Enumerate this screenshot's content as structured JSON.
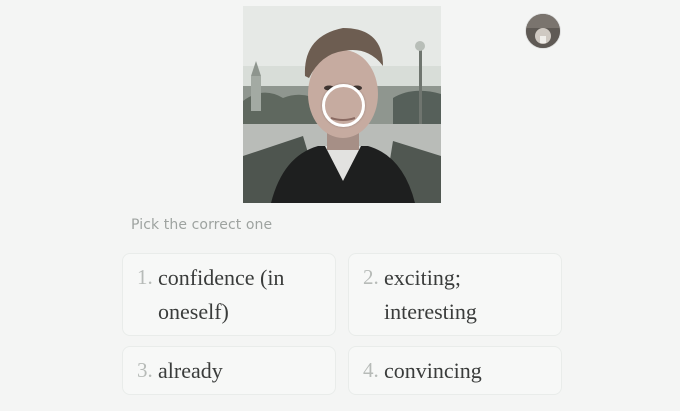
{
  "avatar": {
    "icon": "user-avatar"
  },
  "photo": {
    "subject": "portrait-photo"
  },
  "prompt": "Pick the correct one",
  "options": [
    {
      "number": "1.",
      "text": "confidence (in oneself)"
    },
    {
      "number": "2.",
      "text": "exciting; interesting"
    },
    {
      "number": "3.",
      "text": "already"
    },
    {
      "number": "4.",
      "text": "convincing"
    }
  ],
  "colors": {
    "background": "#f4f5f4",
    "option_bg": "#f7f8f7",
    "number": "#b7bbb8",
    "text": "#3a3c3b",
    "prompt": "#9ea3a0"
  }
}
